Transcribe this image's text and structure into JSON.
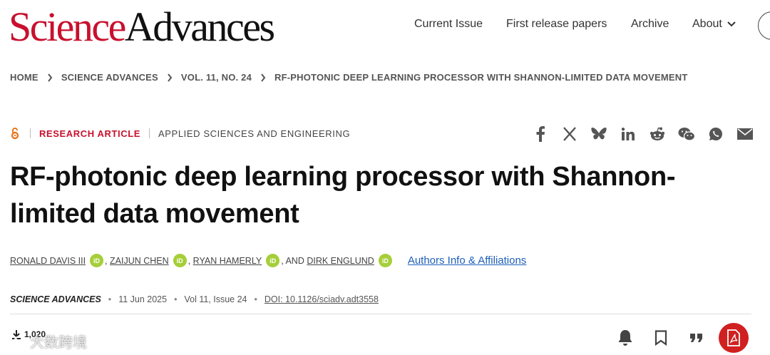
{
  "header": {
    "logo_science": "Science",
    "logo_advances": "Advances",
    "nav": [
      "Current Issue",
      "First release papers",
      "Archive"
    ],
    "nav_about": "About"
  },
  "breadcrumb": [
    "HOME",
    "SCIENCE ADVANCES",
    "VOL. 11, NO. 24",
    "RF-PHOTONIC DEEP LEARNING PROCESSOR WITH SHANNON-LIMITED DATA MOVEMENT"
  ],
  "article": {
    "type": "RESEARCH ARTICLE",
    "subject": "APPLIED SCIENCES AND ENGINEERING",
    "title": "RF-photonic deep learning processor with Shannon-limited data movement",
    "authors": [
      "RONALD DAVIS III",
      "ZAIJUN CHEN",
      "RYAN HAMERLY",
      "DIRK ENGLUND"
    ],
    "author_sep1": ",",
    "author_sep2": ",",
    "author_sep3": ", AND",
    "orcid_label": "iD",
    "affiliations_link": "Authors Info & Affiliations",
    "journal": "SCIENCE ADVANCES",
    "date": "11 Jun 2025",
    "volume": "Vol 11, Issue 24",
    "doi": "DOI: 10.1126/sciadv.adt3558",
    "downloads": "1,020"
  },
  "share_icons": [
    "facebook-icon",
    "x-icon",
    "bluesky-icon",
    "linkedin-icon",
    "reddit-icon",
    "wechat-icon",
    "whatsapp-icon",
    "email-icon"
  ],
  "watermark": "大数跨境",
  "colors": {
    "brand_red": "#c8102e",
    "orcid_green": "#a6ce39",
    "link_blue": "#1d5fb8",
    "pdf_red": "#d0201f"
  }
}
